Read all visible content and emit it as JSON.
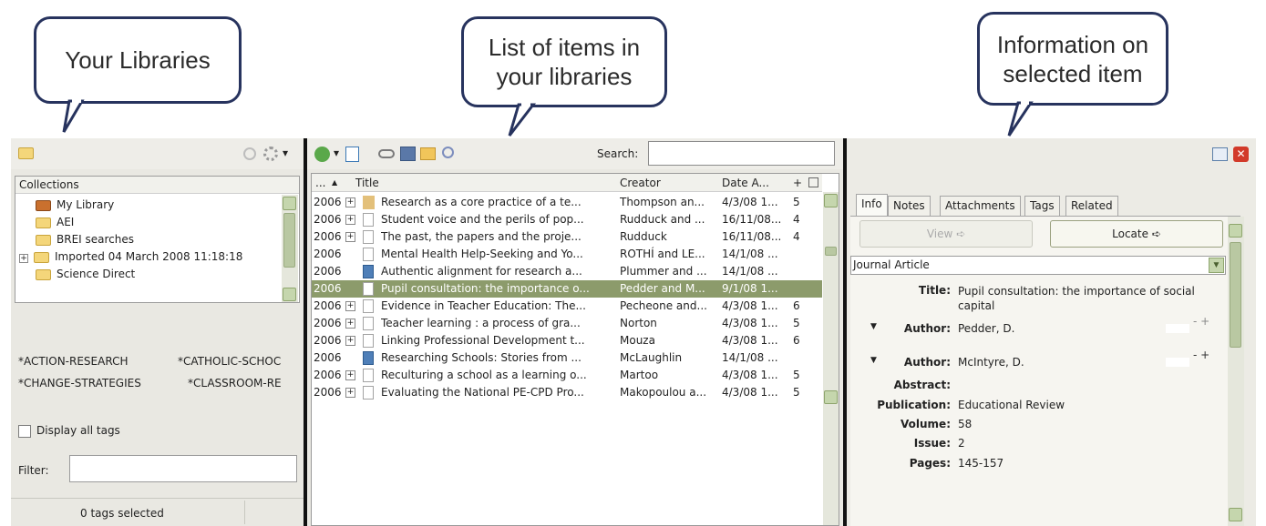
{
  "callouts": {
    "left": "Your Libraries",
    "mid": "List of items in your libraries",
    "right": "Information on selected item"
  },
  "left": {
    "collections_header": "Collections",
    "collections": [
      "My Library",
      "AEI",
      "BREI searches",
      "Imported 04 March 2008 11:18:18",
      "Science Direct"
    ],
    "tags": [
      [
        "*ACTION-RESEARCH",
        "*CATHOLIC-SCHOC"
      ],
      [
        "*CHANGE-STRATEGIES",
        "*CLASSROOM-RE"
      ]
    ],
    "display_all_tags": "Display all tags",
    "filter_label": "Filter:",
    "filter_value": "",
    "tags_selected": "0 tags selected"
  },
  "mid": {
    "search_label": "Search:",
    "search_value": "",
    "columns": {
      "sort": "...",
      "title": "Title",
      "creator": "Creator",
      "date": "Date A...",
      "plus": "+"
    },
    "rows": [
      {
        "year": "2006",
        "expand": "+",
        "icon": "web",
        "title": "Research as a core practice of a te...",
        "creator": "Thompson an...",
        "date": "4/3/08 1...",
        "n": "5"
      },
      {
        "year": "2006",
        "expand": "+",
        "icon": "doc",
        "title": "Student voice and the perils of pop...",
        "creator": "Rudduck and ...",
        "date": "16/11/08...",
        "n": "4"
      },
      {
        "year": "2006",
        "expand": "+",
        "icon": "doc",
        "title": "The past, the papers and the proje...",
        "creator": "Rudduck",
        "date": "16/11/08...",
        "n": "4"
      },
      {
        "year": "2006",
        "expand": "",
        "icon": "doc",
        "title": "Mental Health Help-Seeking and Yo...",
        "creator": "ROTHÍ and LE...",
        "date": "14/1/08 ...",
        "n": ""
      },
      {
        "year": "2006",
        "expand": "",
        "icon": "book",
        "title": "Authentic alignment for research a...",
        "creator": "Plummer and ...",
        "date": "14/1/08 ...",
        "n": ""
      },
      {
        "year": "2006",
        "expand": "",
        "icon": "doc",
        "title": "Pupil consultation: the importance o...",
        "creator": "Pedder and M...",
        "date": "9/1/08 1...",
        "n": "",
        "selected": true
      },
      {
        "year": "2006",
        "expand": "+",
        "icon": "doc",
        "title": "Evidence in Teacher Education: The...",
        "creator": "Pecheone and...",
        "date": "4/3/08 1...",
        "n": "6"
      },
      {
        "year": "2006",
        "expand": "+",
        "icon": "doc",
        "title": "Teacher learning : a process of gra...",
        "creator": "Norton",
        "date": "4/3/08 1...",
        "n": "5"
      },
      {
        "year": "2006",
        "expand": "+",
        "icon": "doc",
        "title": "Linking Professional Development t...",
        "creator": "Mouza",
        "date": "4/3/08 1...",
        "n": "6"
      },
      {
        "year": "2006",
        "expand": "",
        "icon": "book",
        "title": "Researching Schools: Stories from ...",
        "creator": "McLaughlin",
        "date": "14/1/08 ...",
        "n": ""
      },
      {
        "year": "2006",
        "expand": "+",
        "icon": "doc",
        "title": "Reculturing a school as a learning o...",
        "creator": "Martoo",
        "date": "4/3/08 1...",
        "n": "5"
      },
      {
        "year": "2006",
        "expand": "+",
        "icon": "doc",
        "title": "Evaluating the National PE-CPD Pro...",
        "creator": "Makopoulou a...",
        "date": "4/3/08 1...",
        "n": "5"
      }
    ]
  },
  "right": {
    "tabs": [
      "Info",
      "Notes",
      "Attachments",
      "Tags",
      "Related"
    ],
    "view_button": "View ➪",
    "locate_button": "Locate ➪",
    "item_type": "Journal Article",
    "fields": [
      {
        "label": "Title:",
        "value": "Pupil consultation: the importance of social capital"
      },
      {
        "label": "Author:",
        "value": "Pedder,  D.",
        "toggle": true
      },
      {
        "label": "Author:",
        "value": "McIntyre,  D.",
        "toggle": true
      },
      {
        "label": "Abstract:",
        "value": ""
      },
      {
        "label": "Publication:",
        "value": "Educational Review"
      },
      {
        "label": "Volume:",
        "value": "58"
      },
      {
        "label": "Issue:",
        "value": "2"
      },
      {
        "label": "Pages:",
        "value": "145-157"
      }
    ],
    "minus_plus": "- +"
  },
  "colors": {
    "selection": "#8c9b6b",
    "callout_border": "#27335e",
    "divider": "#111111"
  }
}
